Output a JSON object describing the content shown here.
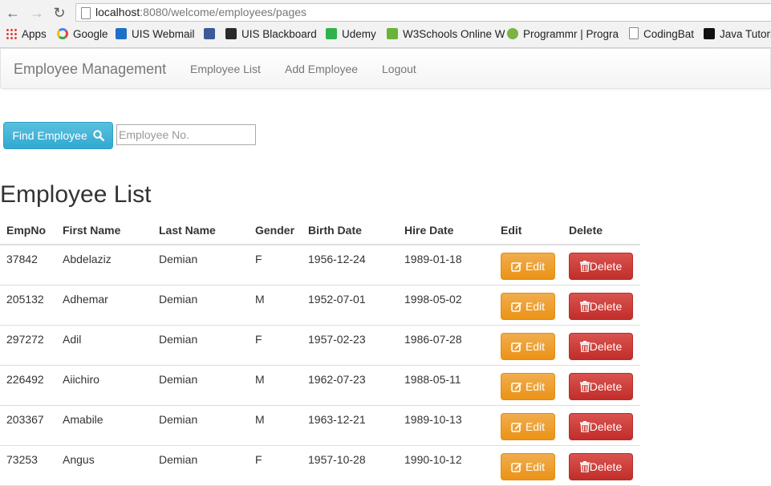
{
  "browser": {
    "url_host": "localhost",
    "url_rest": ":8080/welcome/employees/pages",
    "bookmarks": [
      {
        "label": "Apps",
        "icon": "apps-grid-icon"
      },
      {
        "label": "Google",
        "icon": "google-icon"
      },
      {
        "label": "UIS Webmail",
        "icon": "outlook-icon"
      },
      {
        "label": "",
        "icon": "facebook-icon"
      },
      {
        "label": "UIS Blackboard",
        "icon": "blackboard-icon"
      },
      {
        "label": "Udemy",
        "icon": "udemy-icon"
      },
      {
        "label": "W3Schools Online W",
        "icon": "w3schools-icon"
      },
      {
        "label": "Programmr | Progra",
        "icon": "programmr-icon"
      },
      {
        "label": "CodingBat",
        "icon": "page-icon"
      },
      {
        "label": "Java Tutori",
        "icon": "java-icon"
      }
    ]
  },
  "navbar": {
    "brand": "Employee Management",
    "links": [
      "Employee List",
      "Add Employee",
      "Logout"
    ]
  },
  "search": {
    "button_label": "Find Employee",
    "placeholder": "Employee No."
  },
  "page_title": "Employee List",
  "table": {
    "columns": [
      "EmpNo",
      "First Name",
      "Last Name",
      "Gender",
      "Birth Date",
      "Hire Date",
      "Edit",
      "Delete"
    ],
    "edit_label": "Edit",
    "delete_label": "Delete",
    "rows": [
      [
        "37842",
        "Abdelaziz",
        "Demian",
        "F",
        "1956-12-24",
        "1989-01-18"
      ],
      [
        "205132",
        "Adhemar",
        "Demian",
        "M",
        "1952-07-01",
        "1998-05-02"
      ],
      [
        "297272",
        "Adil",
        "Demian",
        "F",
        "1957-02-23",
        "1986-07-28"
      ],
      [
        "226492",
        "Aiichiro",
        "Demian",
        "M",
        "1962-07-23",
        "1988-05-11"
      ],
      [
        "203367",
        "Amabile",
        "Demian",
        "M",
        "1963-12-21",
        "1989-10-13"
      ],
      [
        "73253",
        "Angus",
        "Demian",
        "F",
        "1957-10-28",
        "1990-10-12"
      ]
    ]
  },
  "colors": {
    "info": "#5bc0de",
    "warning": "#f0ad4e",
    "danger": "#d9534f"
  }
}
